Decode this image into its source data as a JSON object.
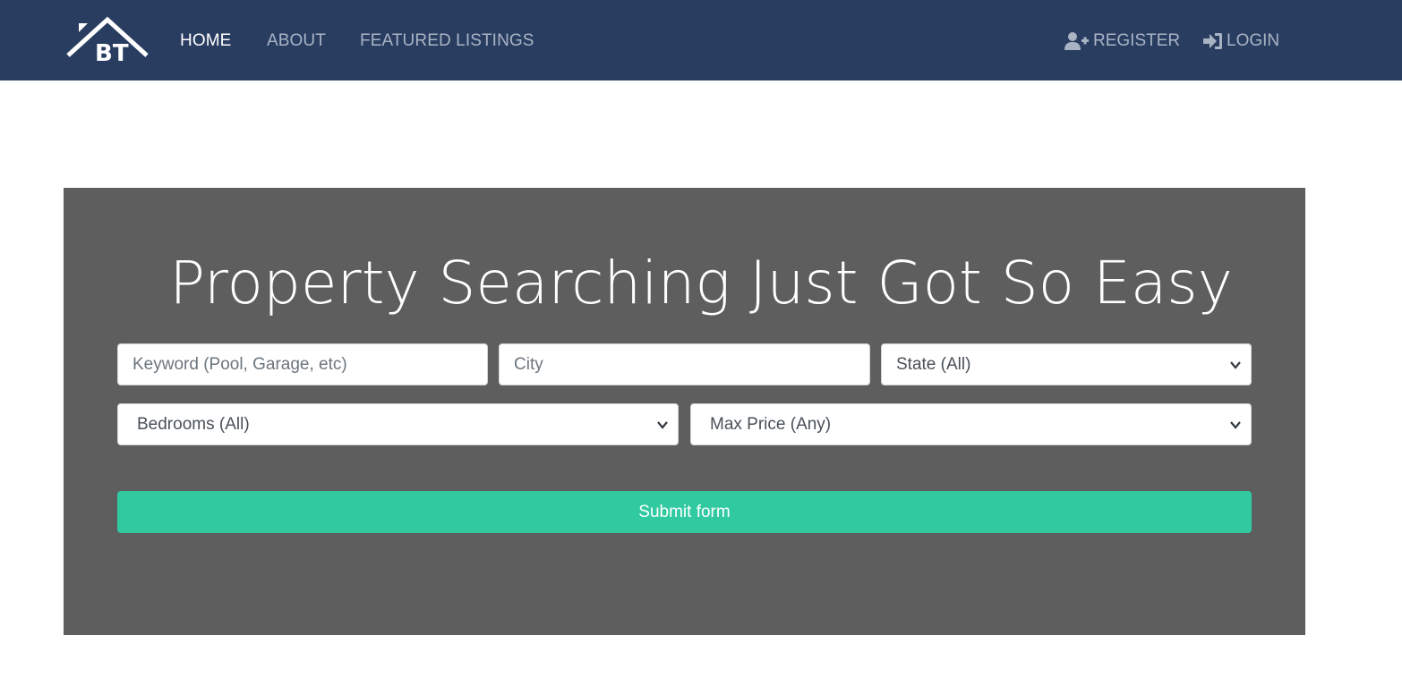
{
  "brand": {
    "logo_text": "BT",
    "logo_icon": "house-roof-logo"
  },
  "nav": {
    "home": "HOME",
    "about": "ABOUT",
    "featured": "FEATURED LISTINGS",
    "register": "REGISTER",
    "login": "LOGIN",
    "register_icon": "user-plus-icon",
    "login_icon": "sign-in-icon"
  },
  "showcase": {
    "title": "Property Searching Just Got So Easy"
  },
  "search": {
    "keyword_placeholder": "Keyword (Pool, Garage, etc)",
    "city_placeholder": "City",
    "state_selected": "State (All)",
    "bedrooms_selected": "Bedrooms (All)",
    "max_price_selected": "Max Price (Any)",
    "submit_label": "Submit form"
  },
  "colors": {
    "navbar_bg": "#293d61",
    "nav_link": "#a9b3c4",
    "nav_active": "#ffffff",
    "showcase_bg": "#5e5e5e",
    "submit_bg": "#30c9a0"
  }
}
